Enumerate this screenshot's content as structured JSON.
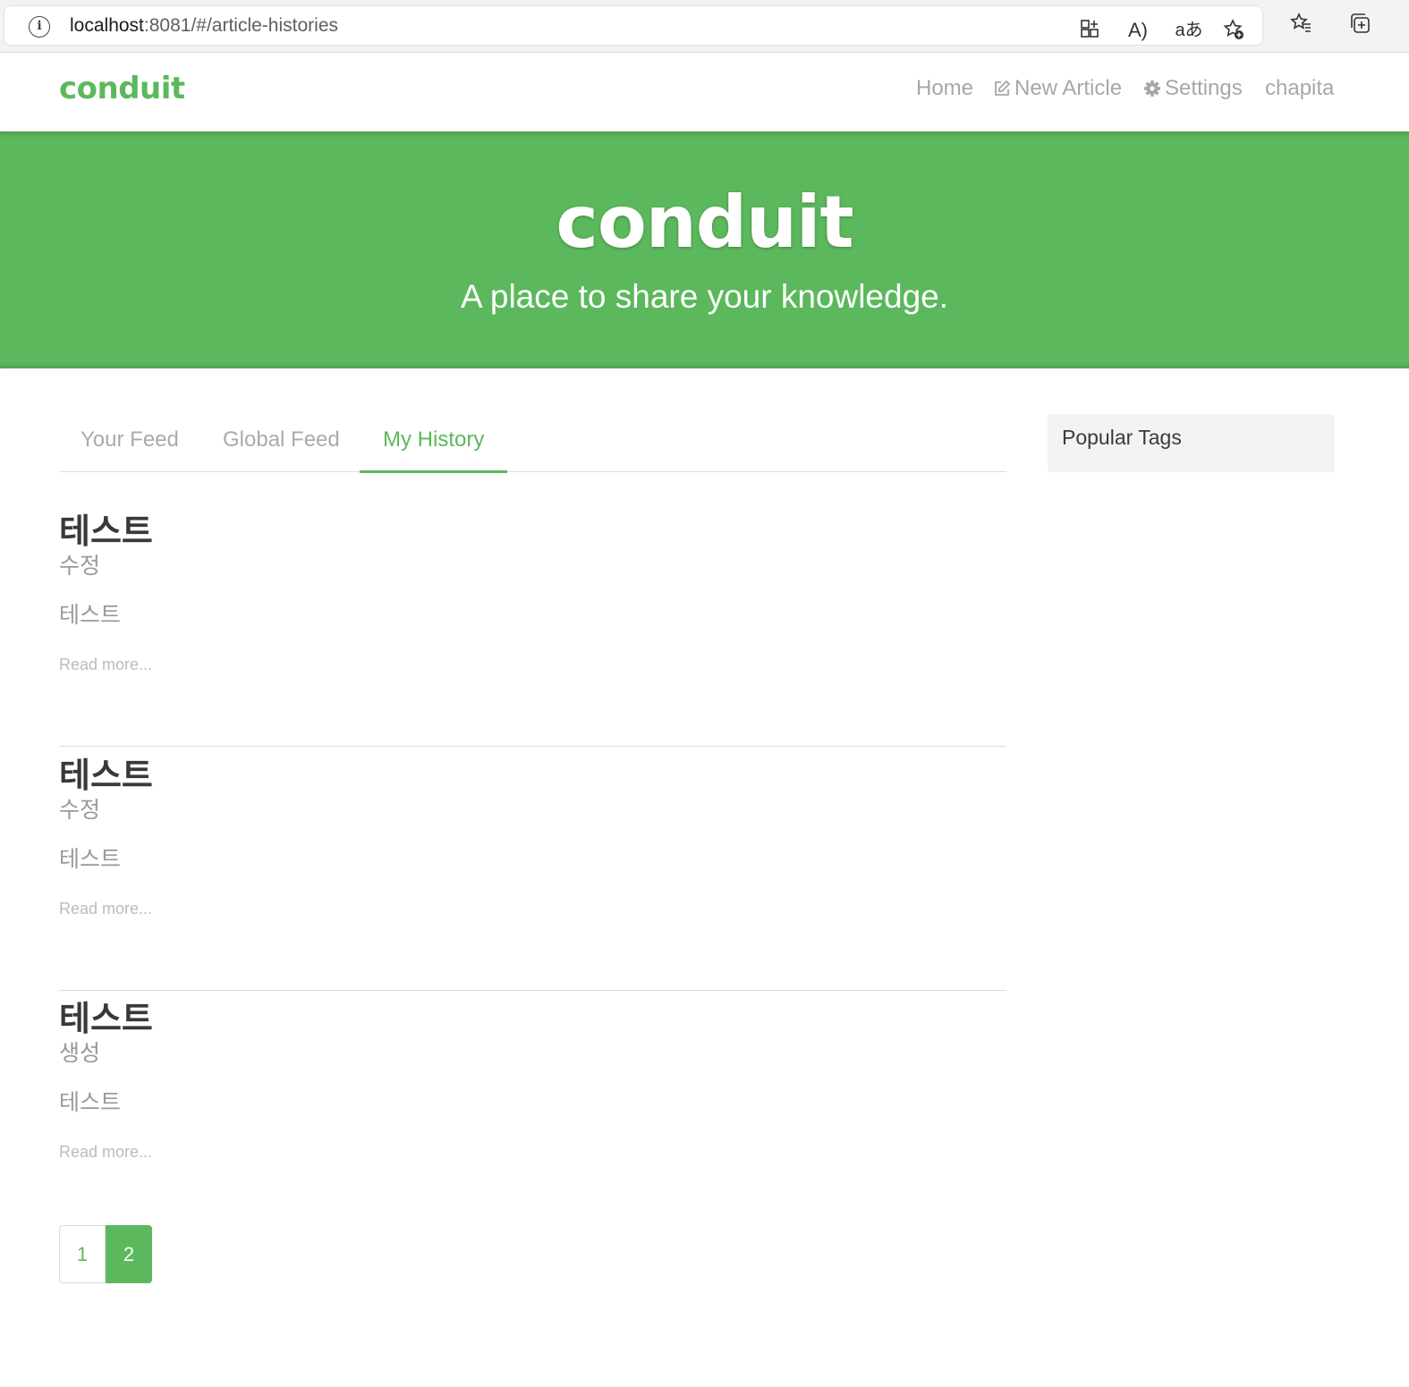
{
  "browser": {
    "url_host": "localhost",
    "url_rest": ":8081/#/article-histories",
    "icons": [
      "info-icon",
      "app-grid-icon",
      "read-aloud-icon",
      "translate-icon",
      "add-favorite-icon",
      "favorites-icon",
      "collections-icon"
    ],
    "read_aloud_glyph": "A)",
    "translate_glyph": "aあ"
  },
  "navbar": {
    "brand": "conduit",
    "items": {
      "home": "Home",
      "new_article": "New Article",
      "settings": "Settings",
      "profile": "chapita"
    }
  },
  "banner": {
    "title": "conduit",
    "subtitle": "A place to share your knowledge."
  },
  "feed": {
    "tabs": [
      "Your Feed",
      "Global Feed",
      "My History"
    ],
    "active_tab": "My History"
  },
  "articles": [
    {
      "title": "테스트",
      "subtitle": "수정",
      "body": "테스트",
      "read_more": "Read more..."
    },
    {
      "title": "테스트",
      "subtitle": "수정",
      "body": "테스트",
      "read_more": "Read more..."
    },
    {
      "title": "테스트",
      "subtitle": "생성",
      "body": "테스트",
      "read_more": "Read more..."
    }
  ],
  "pagination": {
    "pages": [
      "1",
      "2"
    ],
    "current": "2"
  },
  "sidebar": {
    "title": "Popular Tags"
  },
  "colors": {
    "brand": "#5cb85c",
    "nav_muted": "#a6a6a6",
    "text": "#373a3c"
  }
}
